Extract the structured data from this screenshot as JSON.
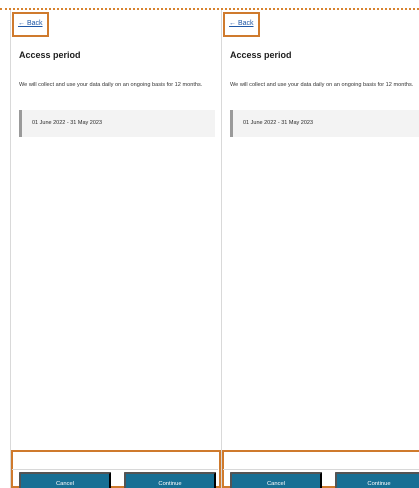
{
  "screen": {
    "accent_color": "#cf7a2d",
    "button_color": "#176f94",
    "link_color": "#1f57a6"
  },
  "panels": [
    {
      "back_label": "← Back",
      "title": "Access period",
      "description": "We will collect and use your data daily on an ongoing basis for 12 months.",
      "period": "01 June 2022 - 31 May 2023",
      "cancel_label": "Cancel",
      "continue_label": "Continue"
    },
    {
      "back_label": "← Back",
      "title": "Access period",
      "description": "We will collect and use your data daily on an ongoing basis for 12 months.",
      "period": "01 June 2022 - 31 May 2023",
      "cancel_label": "Cancel",
      "continue_label": "Continue"
    }
  ]
}
